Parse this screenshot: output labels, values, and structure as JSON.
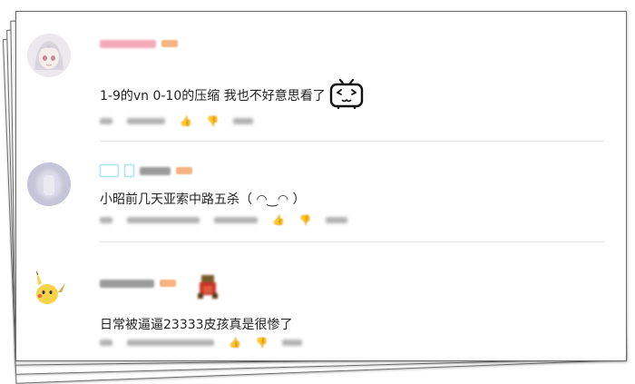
{
  "comments": [
    {
      "text": "1-9的vn 0-10的压缩 我也不好意思看了",
      "emoji_icon": "bilibili-tv-emoji-icon",
      "avatar_icon": "anime-girl-avatar-icon"
    },
    {
      "text": "小昭前几天亚索中路五杀（ ◠‿◠ ）",
      "avatar_icon": "blurred-avatar-icon"
    },
    {
      "text": "日常被逼逼23333皮孩真是很惨了",
      "avatar_icon": "pikachu-avatar-icon",
      "sticker_icon": "pixel-sticker-icon"
    }
  ],
  "colors": {
    "username_pink": "#f4a7b9",
    "level_orange": "#f6b37f",
    "badge_teal": "#7ad6d8",
    "text": "#222222",
    "meta_gray": "#9a9a9a"
  },
  "meta_icons": [
    "thumb-up-icon",
    "thumb-down-icon",
    "reply-icon"
  ]
}
